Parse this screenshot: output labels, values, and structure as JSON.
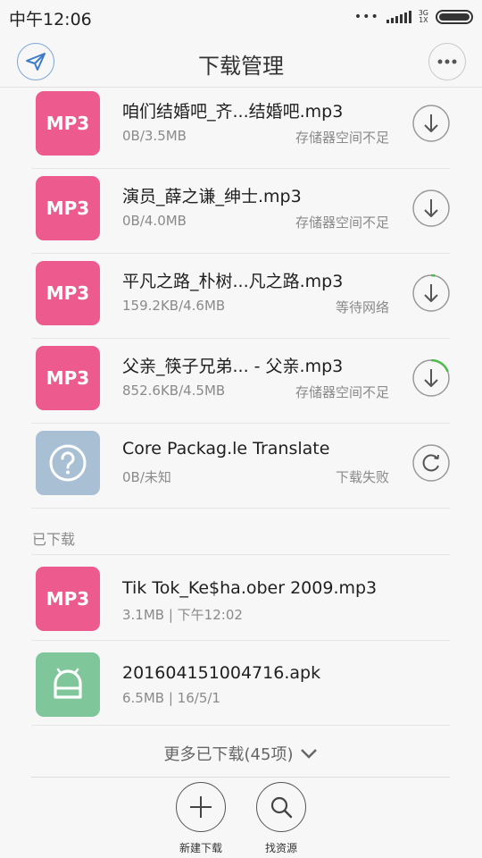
{
  "status_bar": {
    "time": "中午12:06",
    "network": "3G",
    "net_sub": "1X"
  },
  "header": {
    "title": "下载管理"
  },
  "downloading": [
    {
      "icon": "mp3",
      "tile_label": "MP3",
      "name": "咱们结婚吧_齐...结婚吧.mp3",
      "size": "0B/3.5MB",
      "status": "存储器空间不足",
      "action": "download-icon",
      "progress": 0
    },
    {
      "icon": "mp3",
      "tile_label": "MP3",
      "name": "演员_薛之谦_绅士.mp3",
      "size": "0B/4.0MB",
      "status": "存储器空间不足",
      "action": "download-icon",
      "progress": 0
    },
    {
      "icon": "mp3",
      "tile_label": "MP3",
      "name": "平凡之路_朴树...凡之路.mp3",
      "size": "159.2KB/4.6MB",
      "status": "等待网络",
      "action": "download-icon",
      "progress": 0.035
    },
    {
      "icon": "mp3",
      "tile_label": "MP3",
      "name": "父亲_筷子兄弟... - 父亲.mp3",
      "size": "852.6KB/4.5MB",
      "status": "存储器空间不足",
      "action": "download-icon",
      "progress": 0.19
    },
    {
      "icon": "unknown",
      "tile_label": "",
      "name": "Core Packag.le Translate",
      "size": "0B/未知",
      "status": "下载失败",
      "action": "retry-icon",
      "progress": 0
    }
  ],
  "completed_section": {
    "label": "已下载"
  },
  "completed": [
    {
      "icon": "mp3",
      "tile_label": "MP3",
      "name": "Tik Tok_Ke$ha.ober 2009.mp3",
      "meta": "3.1MB | 下午12:02"
    },
    {
      "icon": "apk",
      "tile_label": "",
      "name": "201604151004716.apk",
      "meta": "6.5MB | 16/5/1"
    }
  ],
  "more": {
    "label": "更多已下载(45项)"
  },
  "bottom_bar": {
    "new_download": "新建下载",
    "find_resources": "找资源"
  },
  "colors": {
    "mp3_tile": "#ed5a8d",
    "unknown_tile": "#a9bfd4",
    "apk_tile": "#7fc79a",
    "progress": "#4cbb4c",
    "accent_blue": "#3d7cc9"
  }
}
